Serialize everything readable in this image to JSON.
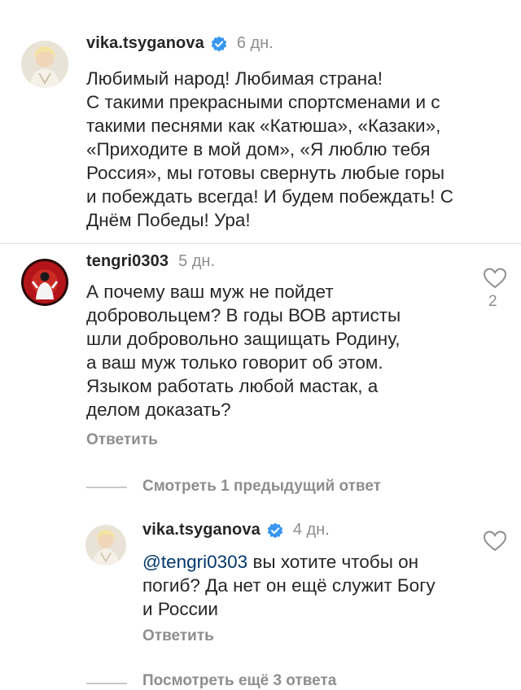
{
  "comments": [
    {
      "username": "vika.tsyganova",
      "time": "6 дн.",
      "verified": true,
      "text": "Любимый народ! Любимая страна!\nС такими прекрасными спортсменами и с\nтакими песнями как «Катюша», «Казаки»,\n«Приходите в мой дом», «Я люблю тебя\nРоссия», мы готовы свернуть любые горы\nи побеждать всегда! И будем побеждать! С\nДнём Победы! Ура!"
    },
    {
      "username": "tengri0303",
      "time": "5 дн.",
      "text": "А  почему ваш муж не пойдет\nдобровольцем? В годы ВОВ артисты\nшли добровольно защищать Родину,\nа ваш муж только говорит об этом.\nЯзыком работать любой мастак, а\nделом доказать?",
      "reply_label": "Ответить",
      "likes": "2",
      "view_previous": "Смотреть 1 предыдущий ответ"
    },
    {
      "username": "vika.tsyganova",
      "time": "4 дн.",
      "verified": true,
      "mention": "@tengri0303",
      "text": " вы хотите чтобы он\nпогиб? Да нет он ещё служит Богу\nи России",
      "reply_label": "Ответить"
    }
  ],
  "footer": {
    "more_replies": "Посмотреть ещё 3 ответа"
  },
  "colors": {
    "verified": "#3897f0",
    "secondary": "#8e8e8e",
    "mention": "#00376b"
  }
}
